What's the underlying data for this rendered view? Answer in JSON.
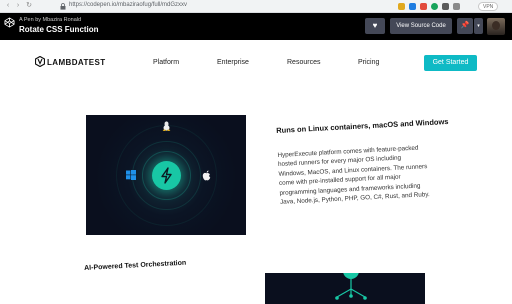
{
  "browser": {
    "url": "https://codepen.io/mbaziraofug/full/mdGzxxv",
    "vpn_label": "VPN",
    "extension_colors": [
      "#e0a81f",
      "#1f7de0",
      "#e24a3b",
      "#19a35b",
      "#5a5a5a",
      "#8a8a8a"
    ]
  },
  "codepen": {
    "by_line": "A Pen by Mbazira Ronald",
    "title": "Rotate CSS Function",
    "heart_icon": "heart-icon",
    "view_source_label": "View Source Code",
    "pin_icon": "pin-icon",
    "dropdown_icon": "chevron-down-icon"
  },
  "lambdatest": {
    "brand": "LAMBDATEST",
    "nav": [
      "Platform",
      "Enterprise",
      "Resources",
      "Pricing"
    ],
    "cta": "Get Started"
  },
  "section1": {
    "heading": "Runs on Linux containers, macOS and Windows",
    "body": "HyperExecute platform comes with feature-packed hosted runners for every major OS including Windows, MacOS, and Linux containers. The runners come with pre-installed support for all major programming languages and frameworks including Java, Node.js, Python, PHP, GO, C#, Rust, and Ruby.",
    "icons": [
      "linux-icon",
      "windows-icon",
      "apple-icon",
      "lightning-icon"
    ],
    "accent_color": "#18c7a5"
  },
  "section2": {
    "heading": "AI-Powered Test Orchestration"
  }
}
